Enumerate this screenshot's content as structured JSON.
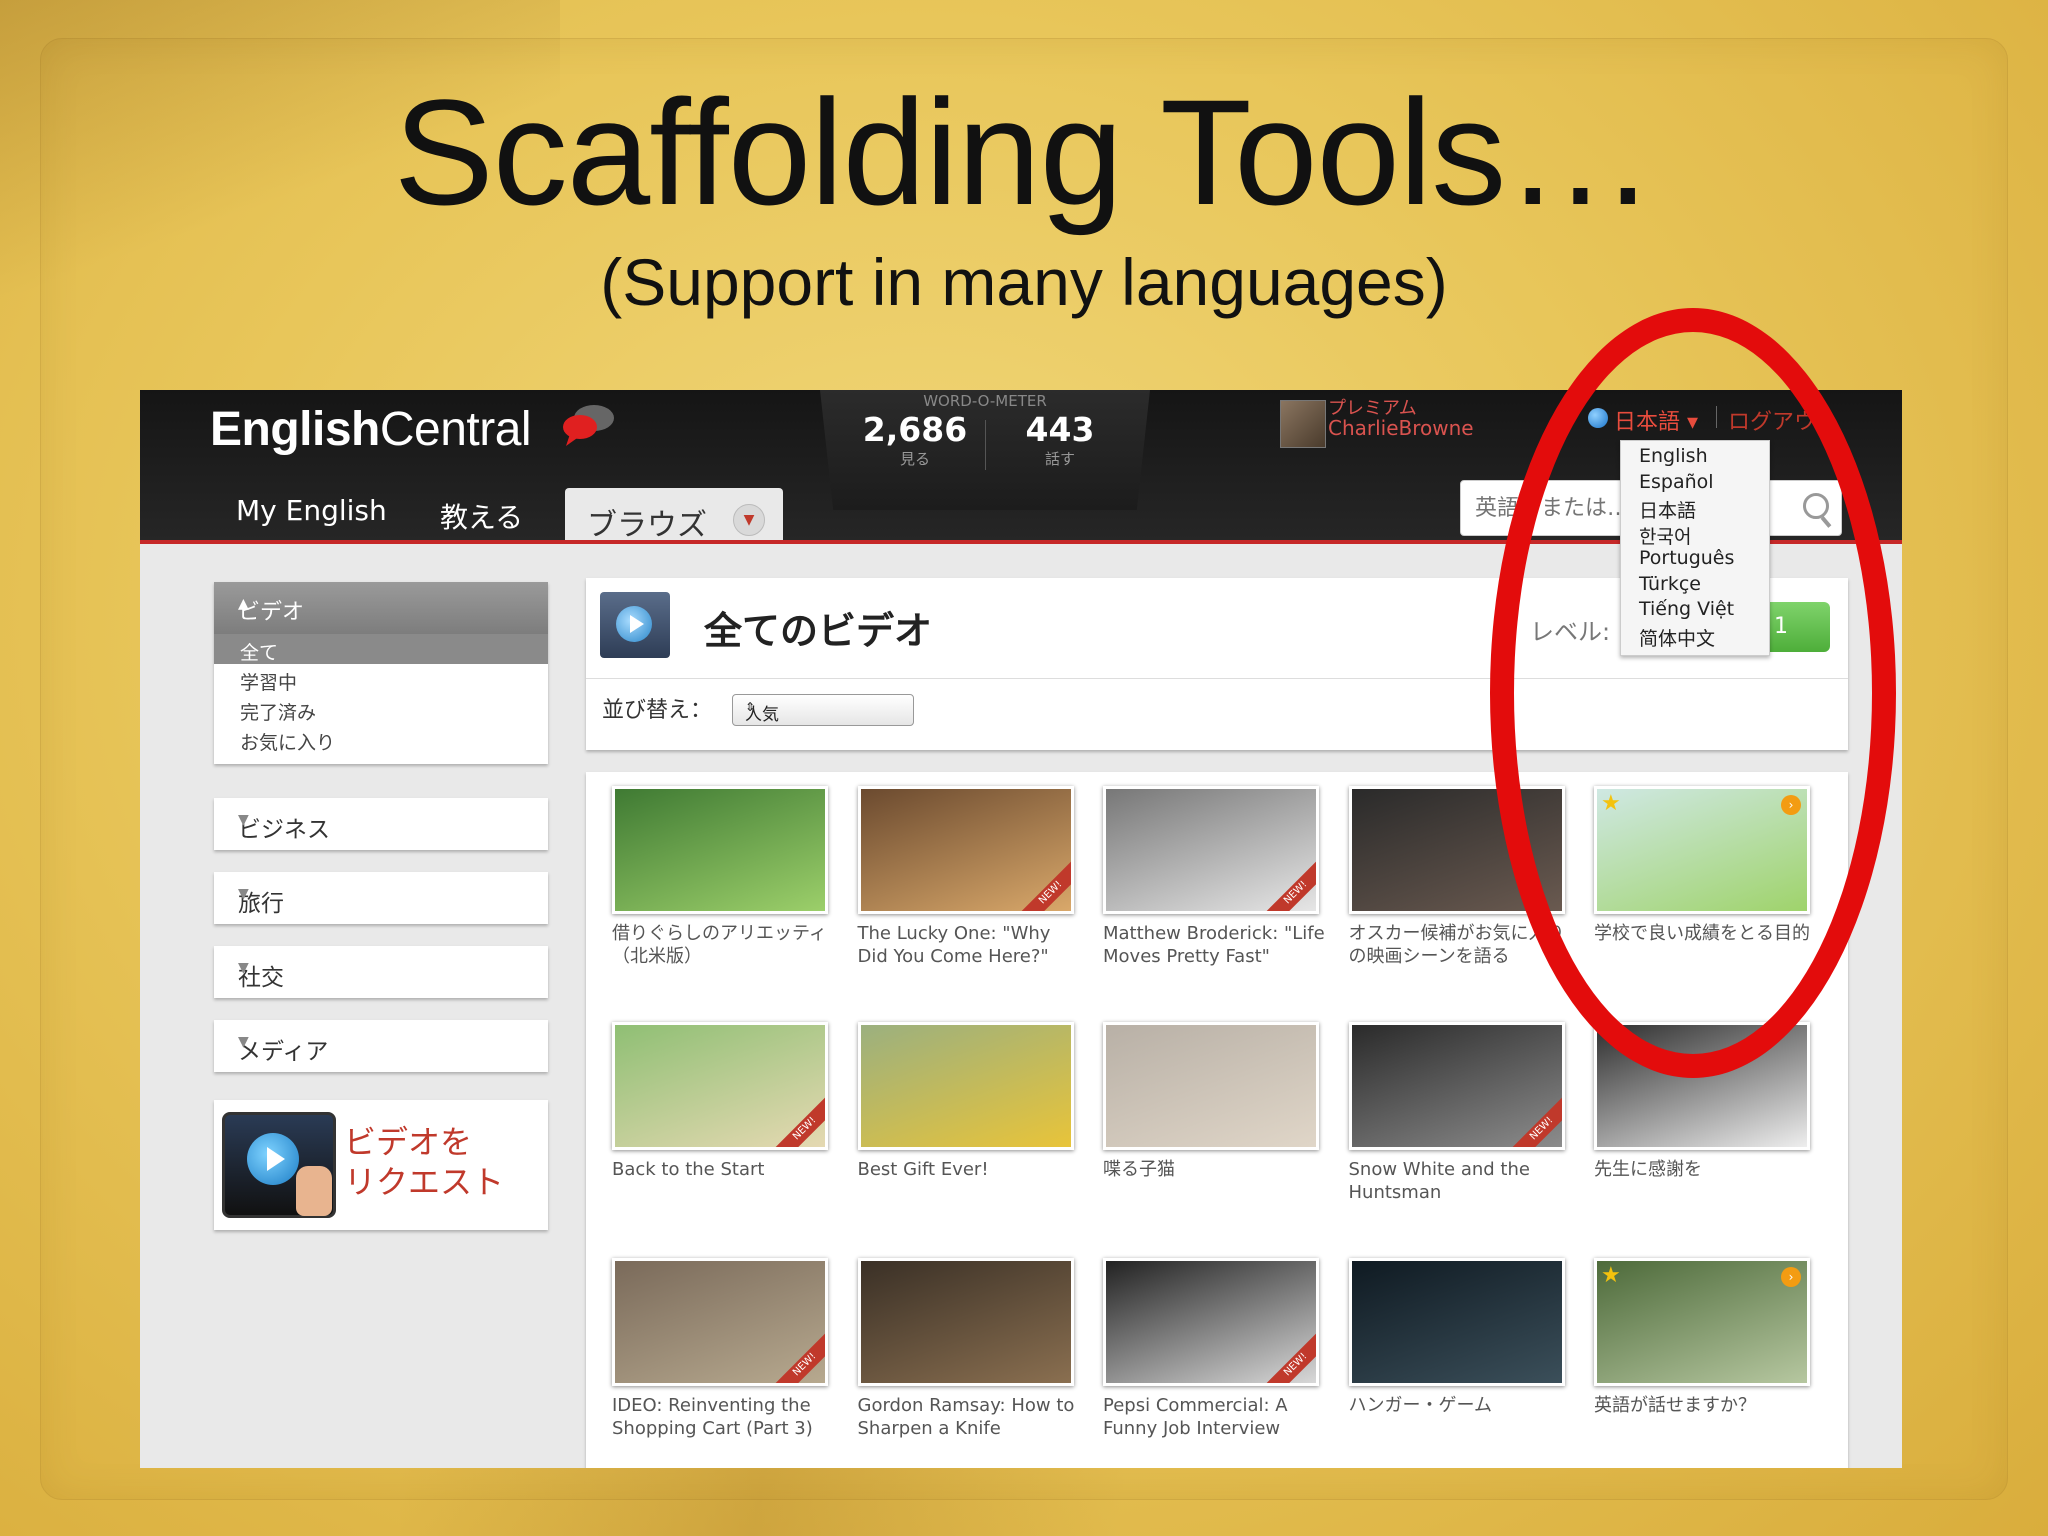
{
  "slide": {
    "title": "Scaffolding Tools…",
    "subtitle": "(Support in many languages)"
  },
  "app": {
    "logo_bold": "English",
    "logo_light": "Central",
    "word_o_meter": {
      "title": "WORD-O-METER",
      "watched_count": "2,686",
      "watched_label": "見る",
      "spoken_count": "443",
      "spoken_label": "話す"
    },
    "user": {
      "tier": "プレミアム",
      "name": "CharlieBrowne"
    },
    "language_current": "日本語 ▾",
    "logout": "ログアウト",
    "nav": {
      "my_english": "My English",
      "teach": "教える",
      "browse": "ブラウズ"
    },
    "search": {
      "placeholder": "英語、または…"
    }
  },
  "language_menu": {
    "options": [
      "English",
      "Español",
      "日本語",
      "한국어",
      "Português",
      "Türkçe",
      "Tiếng Việt",
      "简体中文"
    ]
  },
  "sidebar": {
    "video_section": {
      "title": "ビデオ",
      "items": [
        "全て",
        "学習中",
        "完了済み",
        "お気に入り"
      ]
    },
    "categories": [
      "ビジネス",
      "旅行",
      "社交",
      "メディア"
    ],
    "request": {
      "line1": "ビデオを",
      "line2": "リクエスト"
    }
  },
  "main": {
    "title": "全てのビデオ",
    "sort_label": "並び替え：",
    "sort_value": "人気",
    "level_label": "レベル:",
    "level_value": "1"
  },
  "videos": [
    {
      "title": "借りぐらしのアリエッティ（北米版）",
      "new": false,
      "colors": [
        "#3f7a33",
        "#9ccf6a"
      ]
    },
    {
      "title": "The Lucky One: \"Why Did You Come Here?\"",
      "new": true,
      "colors": [
        "#6b4a2f",
        "#d9a86a"
      ]
    },
    {
      "title": "Matthew Broderick: \"Life Moves Pretty Fast\"",
      "new": true,
      "colors": [
        "#777777",
        "#e6e6e6"
      ]
    },
    {
      "title": "オスカー候補がお気に入りの映画シーンを語る",
      "new": false,
      "colors": [
        "#2a2a2a",
        "#6a5a50"
      ]
    },
    {
      "title": "学校で良い成績をとる目的",
      "new": false,
      "colors": [
        "#cfe8e3",
        "#9fd36b"
      ],
      "star": true,
      "next": true
    },
    {
      "title": "Back to the Start",
      "new": true,
      "colors": [
        "#8fbf74",
        "#e5d9b2"
      ]
    },
    {
      "title": "Best Gift Ever!",
      "new": false,
      "colors": [
        "#9bb07f",
        "#e8c43a"
      ]
    },
    {
      "title": "喋る子猫",
      "new": false,
      "colors": [
        "#b8b0a6",
        "#e0d6c8"
      ]
    },
    {
      "title": "Snow White and the Huntsman",
      "new": true,
      "colors": [
        "#2a2a2a",
        "#8c8c8c"
      ]
    },
    {
      "title": "先生に感謝を",
      "new": false,
      "colors": [
        "#2e2e2e",
        "#eeeeee"
      ]
    },
    {
      "title": "IDEO: Reinventing the Shopping Cart (Part 3)",
      "new": true,
      "colors": [
        "#7a6a5a",
        "#b7a98f"
      ]
    },
    {
      "title": "Gordon Ramsay: How to Sharpen a Knife",
      "new": false,
      "colors": [
        "#3a3026",
        "#8a6f50"
      ]
    },
    {
      "title": "Pepsi Commercial: A Funny Job Interview",
      "new": true,
      "colors": [
        "#222222",
        "#d8d8d8"
      ]
    },
    {
      "title": "ハンガー・ゲーム",
      "new": false,
      "colors": [
        "#0f1a22",
        "#3b4f5a"
      ]
    },
    {
      "title": "英語が話せますか？",
      "new": false,
      "colors": [
        "#4d6a3a",
        "#b6c7a0"
      ],
      "star": true,
      "next": true
    }
  ],
  "colors": {
    "slide_bg": "#e8c65a",
    "accent_red": "#c0392b",
    "annotation_red": "#e30c0c",
    "level_green": "#4eae3a"
  }
}
